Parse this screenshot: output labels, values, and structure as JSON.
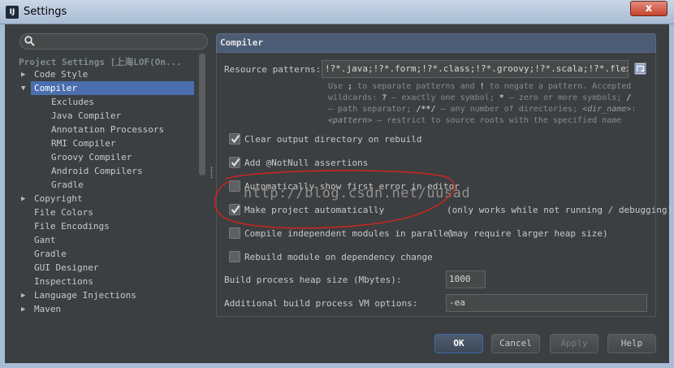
{
  "window": {
    "title": "Settings",
    "app_icon": "IJ",
    "close": "x"
  },
  "search": {
    "placeholder": "",
    "icon": "search-icon"
  },
  "tree": {
    "header": "Project Settings [上海LOF(On...",
    "items": [
      {
        "label": "Code Style",
        "expandable": true,
        "expanded": false
      },
      {
        "label": "Compiler",
        "expandable": true,
        "expanded": true,
        "selected": true
      },
      {
        "label": "Excludes"
      },
      {
        "label": "Java Compiler"
      },
      {
        "label": "Annotation Processors"
      },
      {
        "label": "RMI Compiler"
      },
      {
        "label": "Groovy Compiler"
      },
      {
        "label": "Android Compilers"
      },
      {
        "label": "Gradle"
      },
      {
        "label": "Copyright",
        "expandable": true,
        "expanded": false
      },
      {
        "label": "File Colors"
      },
      {
        "label": "File Encodings"
      },
      {
        "label": "Gant"
      },
      {
        "label": "Gradle"
      },
      {
        "label": "GUI Designer"
      },
      {
        "label": "Inspections"
      },
      {
        "label": "Language Injections",
        "expandable": true,
        "expanded": false
      },
      {
        "label": "Maven",
        "expandable": true,
        "expanded": false
      }
    ]
  },
  "panel": {
    "title": "Compiler",
    "resource_patterns_label": "Resource patterns:",
    "resource_patterns_value": "!?*.java;!?*.form;!?*.class;!?*.groovy;!?*.scala;!?*.flex;!?*",
    "hint_line1_a": "Use ",
    "hint_line1_b": ";",
    "hint_line1_c": " to separate patterns and ",
    "hint_line1_d": "!",
    "hint_line1_e": " to negate a pattern. Accepted",
    "hint_line2_a": "wildcards: ",
    "hint_line2_b": "?",
    "hint_line2_c": " — exactly one symbol; ",
    "hint_line2_d": "*",
    "hint_line2_e": " — zero or more symbols; ",
    "hint_line2_f": "/",
    "hint_line3_a": "— path separator; ",
    "hint_line3_b": "/**/",
    "hint_line3_c": " — any number of directories; ",
    "hint_line3_d": "<dir_name>",
    "hint_line3_e": ":",
    "hint_line4_a": "<pattern>",
    "hint_line4_b": " — restrict to source roots with the specified name",
    "options": [
      {
        "label": "Clear output directory on rebuild",
        "checked": true,
        "note": ""
      },
      {
        "label": "Add @NotNull assertions",
        "checked": true,
        "note": ""
      },
      {
        "label": "Automatically show first error in editor",
        "checked": false,
        "note": ""
      },
      {
        "label": "Make project automatically",
        "checked": true,
        "note": "(only works while not running / debugging)"
      },
      {
        "label": "Compile independent modules in parallel",
        "checked": false,
        "note": "(may require larger heap size)"
      },
      {
        "label": "Rebuild module on dependency change",
        "checked": false,
        "note": ""
      }
    ],
    "heap_label": "Build process heap size (Mbytes):",
    "heap_value": "1000",
    "vm_label": "Additional build process VM options:",
    "vm_value": "-ea"
  },
  "buttons": {
    "ok": "OK",
    "cancel": "Cancel",
    "apply": "Apply",
    "help": "Help"
  },
  "watermark": "http://blog.csdn.net/uusad",
  "colors": {
    "selection": "#4b6eaf",
    "background": "#3c3f41",
    "annotation": "#d6231e"
  }
}
